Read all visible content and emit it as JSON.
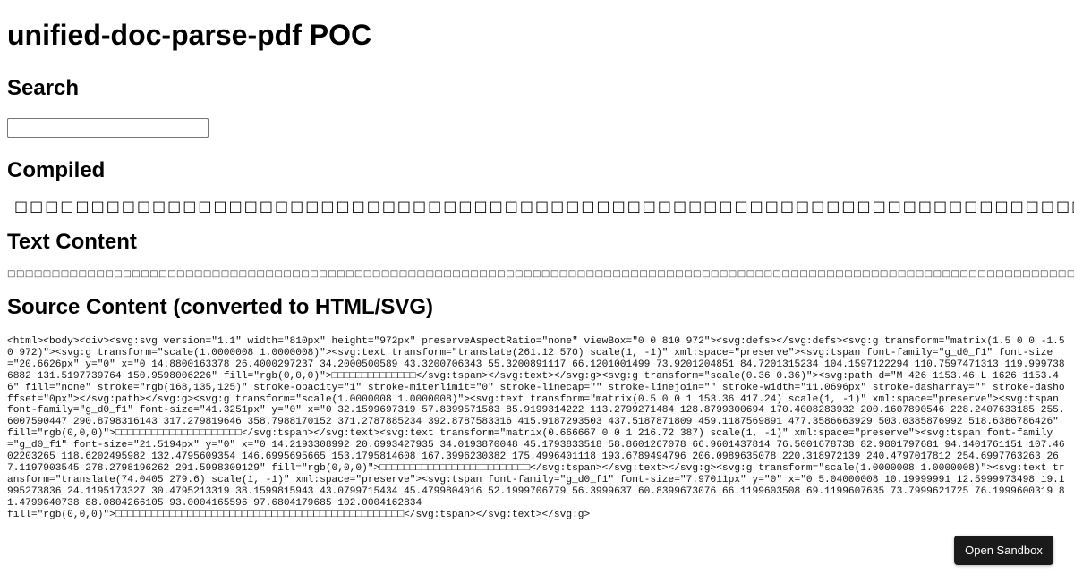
{
  "page": {
    "title": "unified-doc-parse-pdf POC"
  },
  "search": {
    "heading": "Search",
    "value": "",
    "placeholder": ""
  },
  "compiled": {
    "heading": "Compiled",
    "text": "□□□□□□□□□□□□□□□□□□□□□□□□□□□□□□□□□□□□□□□□□□□□□□□□□□□□□□□□□□□□□□□□□□□□□□□□□□□□□□□□□□□□□□□□□□□□"
  },
  "text_content": {
    "heading": "Text Content",
    "text": "□□□□□□□□□□□□□□□□□□□□□□□□□□□□□□□□□□□□□□□□□□□□□□□□□□□□□□□□□□□□□□□□□□□□□□□□□□□□□□□□□□□□□□□□□□□□□□□□□□□□□□□□□□□□□□□□□□□□□□□□□□□□□□□□□□□□□□□□□□□□□□□□□□□□□□□□□□□□□□□□□□□□□□□□□□□□"
  },
  "source": {
    "heading": "Source Content (converted to HTML/SVG)",
    "code": "<html><body><div><svg:svg version=\"1.1\" width=\"810px\" height=\"972px\" preserveAspectRatio=\"none\" viewBox=\"0 0 810 972\"><svg:defs></svg:defs><svg:g transform=\"matrix(1.5 0 0 -1.5 0 972)\"><svg:g transform=\"scale(1.0000008 1.0000008)\"><svg:text transform=\"translate(261.12 570) scale(1, -1)\" xml:space=\"preserve\"><svg:tspan font-family=\"g_d0_f1\" font-size=\"20.6626px\" y=\"0\" x=\"0 14.8800163378 26.4000297237 34.2000500589 43.3200706343 55.3200891117 66.1201001499 73.9201204851 84.7201315234 104.1597122294 110.7597471313 119.9997386882 131.5197739764 150.9598006226\" fill=\"rgb(0,0,0)\">□□□□□□□□□□□□□□</svg:tspan></svg:text></svg:g><svg:g transform=\"scale(0.36 0.36)\"><svg:path d=\"M 426 1153.46 L 1626 1153.46\" fill=\"none\" stroke=\"rgb(168,135,125)\" stroke-opacity=\"1\" stroke-miterlimit=\"0\" stroke-linecap=\"\" stroke-linejoin=\"\" stroke-width=\"11.0696px\" stroke-dasharray=\"\" stroke-dashoffset=\"0px\"></svg:path></svg:g><svg:g transform=\"scale(1.0000008 1.0000008)\"><svg:text transform=\"matrix(0.5 0 0 1 153.36 417.24) scale(1, -1)\" xml:space=\"preserve\"><svg:tspan font-family=\"g_d0_f1\" font-size=\"41.3251px\" y=\"0\" x=\"0 32.1599697319 57.8399571583 85.9199314222 113.2799271484 128.8799300694 170.4008283932 200.1607890546 228.2407633185 255.6007590447 290.8798316143 317.279819646 358.7988170152 371.2787885234 392.8787583316 415.9187293503 437.5187871809 459.1187569891 477.3586663929 503.0385876992 518.6386786426\" fill=\"rgb(0,0,0)\">□□□□□□□□□□□□□□□□□□□□□</svg:tspan></svg:text><svg:text transform=\"matrix(0.666667 0 0 1 216.72 387) scale(1, -1)\" xml:space=\"preserve\"><svg:tspan font-family=\"g_d0_f1\" font-size=\"21.5194px\" y=\"0\" x=\"0 14.2193308992 20.6993427935 34.0193870048 45.1793833518 58.8601267078 66.9601437814 76.5001678738 82.9801797681 94.1401761151 107.4602203265 118.6202495982 132.4795609354 146.6995695665 153.1795814608 167.3996230382 175.4996401118 193.6789494796 206.0989635078 220.318972139 240.4797017812 254.6997763263 267.1197903545 278.2798196262 291.5998309129\" fill=\"rgb(0,0,0)\">□□□□□□□□□□□□□□□□□□□□□□□□□</svg:tspan></svg:text></svg:g><svg:g transform=\"scale(1.0000008 1.0000008)\"><svg:text transform=\"translate(74.0405 279.6) scale(1, -1)\" xml:space=\"preserve\"><svg:tspan font-family=\"g_d0_f1\" font-size=\"7.97011px\" y=\"0\" x=\"0 5.04000008 10.19999991 12.5999973498 19.1995273836 24.1195173327 30.4795213319 38.1599815943 43.0799715434 45.4799804016 52.1999706779 56.3999637 60.8399673076 66.1199603508 69.1199607635 73.7999621725 76.1999600319 81.4799640738 88.0804266105 93.0004165596 97.6804179685 102.0004162834\nfill=\"rgb(0,0,0)\">□□□□□□□□□□□□□□□□□□□□□□□□□□□□□□□□□□□□□□□□□□□□□□□□</svg:tspan></svg:text></svg:g>"
  },
  "sandbox": {
    "label": "Open Sandbox"
  }
}
